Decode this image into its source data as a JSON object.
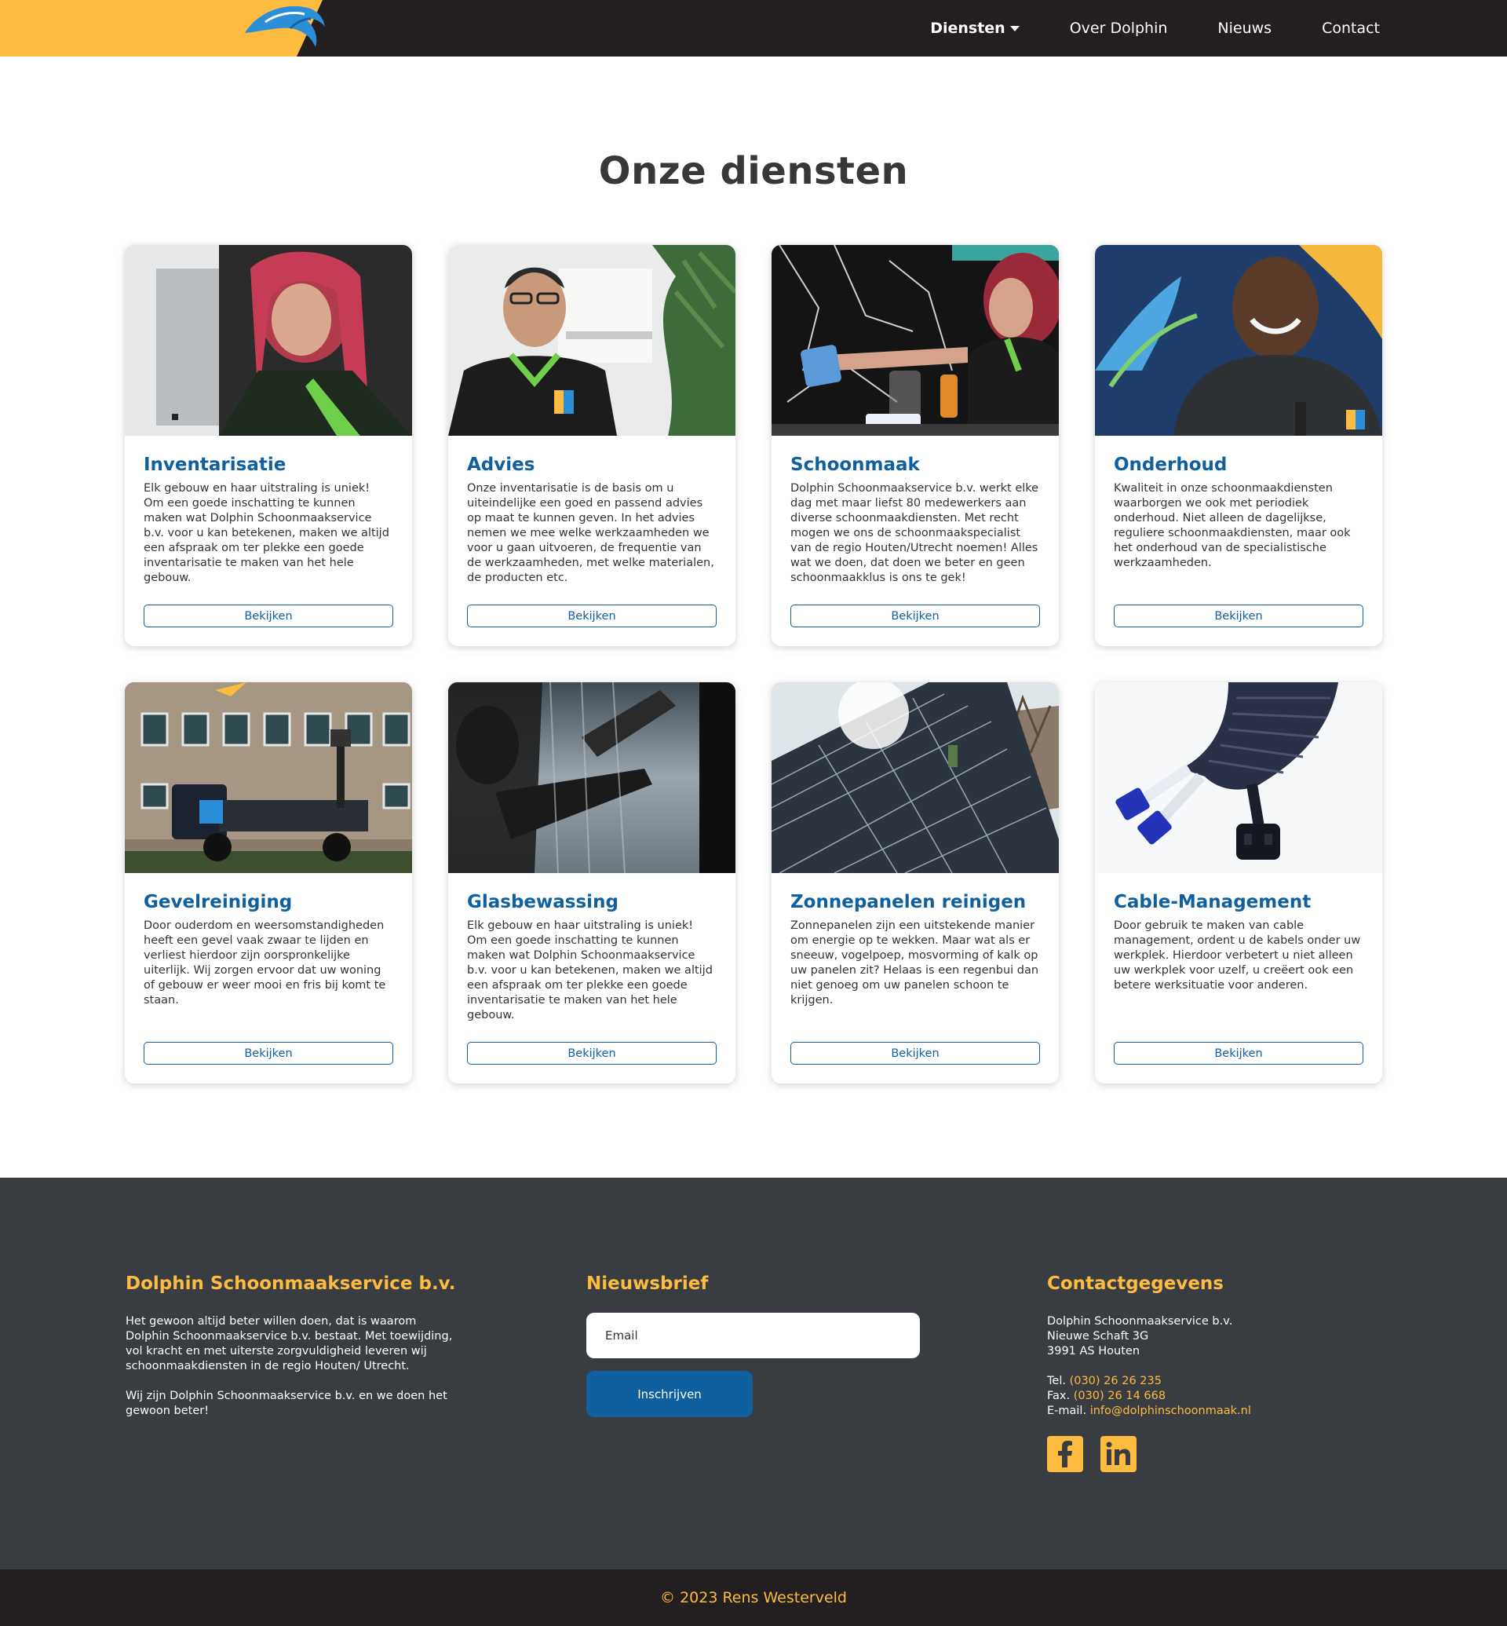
{
  "nav": {
    "logo": "dolphin-logo-icon",
    "items": [
      {
        "label": "Diensten",
        "active": true,
        "dropdown": true
      },
      {
        "label": "Over Dolphin"
      },
      {
        "label": "Nieuws"
      },
      {
        "label": "Contact"
      }
    ]
  },
  "main": {
    "title": "Onze diensten",
    "cards": [
      {
        "title": "Inventarisatie",
        "text": "Elk gebouw en haar uitstraling is uniek! Om een goede inschatting te kunnen maken wat Dolphin Schoonmaakservice b.v. voor u kan betekenen, maken we altijd een afspraak om ter plekke een goede inventarisatie te maken van het hele gebouw.",
        "button": "Bekijken"
      },
      {
        "title": "Advies",
        "text": "Onze inventarisatie is de basis om u uiteindelijke een goed en passend advies op maat te kunnen geven. In het advies nemen we mee welke werkzaamheden we voor u gaan uitvoeren, de frequentie van de werkzaamheden, met welke materialen, de producten etc.",
        "button": "Bekijken"
      },
      {
        "title": "Schoonmaak",
        "text": "Dolphin Schoonmaakservice b.v. werkt elke dag met maar liefst 80 medewerkers aan diverse schoonmaakdiensten. Met recht mogen we ons de schoonmaakspecialist van de regio Houten/Utrecht noemen! Alles wat we doen, dat doen we beter en geen schoonmaakklus is ons te gek!",
        "button": "Bekijken"
      },
      {
        "title": "Onderhoud",
        "text": "Kwaliteit in onze schoonmaakdiensten waarborgen we ook met periodiek onderhoud. Niet alleen de dagelijkse, reguliere schoonmaakdiensten, maar ook het onderhoud van de specialistische werkzaamheden.",
        "button": "Bekijken"
      },
      {
        "title": "Gevelreiniging",
        "text": "Door ouderdom en weersomstandigheden heeft een gevel vaak zwaar te lijden en verliest hierdoor zijn oorspronkelijke uiterlijk. Wij zorgen ervoor dat uw woning of gebouw er weer mooi en fris bij komt te staan.",
        "button": "Bekijken"
      },
      {
        "title": "Glasbewassing",
        "text": "Elk gebouw en haar uitstraling is uniek! Om een goede inschatting te kunnen maken wat Dolphin Schoonmaakservice b.v. voor u kan betekenen, maken we altijd een afspraak om ter plekke een goede inventarisatie te maken van het hele gebouw.",
        "button": "Bekijken"
      },
      {
        "title": "Zonnepanelen reinigen",
        "text": "Zonnepanelen zijn een uitstekende manier om energie op te wekken. Maar wat als er sneeuw, vogelpoep, mosvorming of kalk op uw panelen zit? Helaas is een regenbui dan niet genoeg om uw panelen schoon te krijgen.",
        "button": "Bekijken"
      },
      {
        "title": "Cable-Management",
        "text": "Door gebruik te maken van cable management, ordent u de kabels onder uw werkplek. Hierdoor verbetert u niet alleen uw werkplek voor uzelf, u creëert ook een betere werksituatie voor anderen.",
        "button": "Bekijken"
      }
    ]
  },
  "footer": {
    "about": {
      "title": "Dolphin Schoonmaakservice b.v.",
      "p1": "Het gewoon altijd beter willen doen, dat is waarom Dolphin Schoonmaakservice b.v. bestaat. Met toewijding, vol kracht en met uiterste zorgvuldigheid leveren wij schoonmaakdiensten in de regio Houten/ Utrecht.",
      "p2": "Wij zijn Dolphin Schoonmaakservice b.v. en we doen het gewoon beter!"
    },
    "newsletter": {
      "title": "Nieuwsbrief",
      "email_placeholder": "Email",
      "button": "Inschrijven"
    },
    "contact": {
      "title": "Contactgegevens",
      "name": "Dolphin Schoonmaakservice b.v.",
      "street": "Nieuwe Schaft 3G",
      "city": "3991 AS Houten",
      "tel_label": "Tel.",
      "tel": "(030) 26 26 235",
      "fax_label": "Fax.",
      "fax": "(030) 26 14 668",
      "email_label": "E-mail.",
      "email": "info@dolphinschoonmaak.nl",
      "socials": [
        "facebook-icon",
        "linkedin-icon"
      ]
    },
    "copyright": "© 2023 Rens Westerveld"
  },
  "colors": {
    "brand_yellow": "#fdbb3f",
    "brand_blue": "#1060a0",
    "nav_dark": "#231f20",
    "footer_gray": "#393c40"
  }
}
